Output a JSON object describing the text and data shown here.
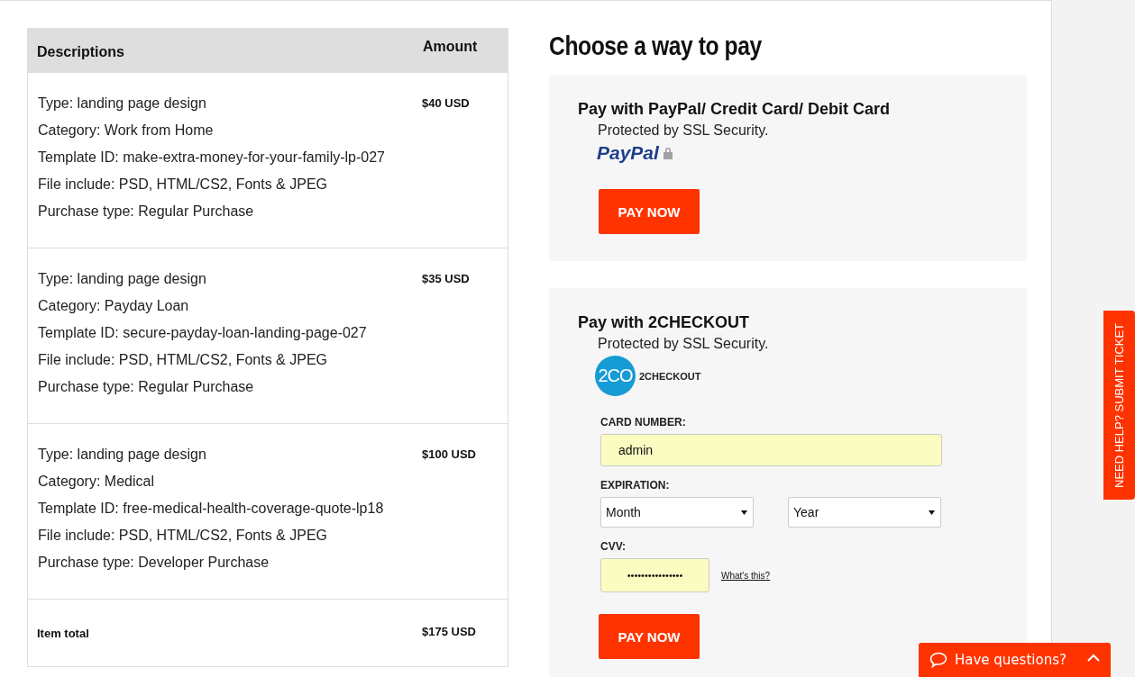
{
  "order_table": {
    "columns": [
      "Descriptions",
      "Amount"
    ],
    "items": [
      {
        "lines": [
          "Type: landing page design",
          "Category: Work from Home",
          "Template ID: make-extra-money-for-your-family-lp-027",
          "File include: PSD, HTML/CS2, Fonts & JPEG",
          "Purchase type: Regular Purchase"
        ],
        "amount": "$40 USD"
      },
      {
        "lines": [
          "Type: landing page design",
          "Category: Payday Loan",
          "Template ID: secure-payday-loan-landing-page-027",
          "File include: PSD, HTML/CS2, Fonts & JPEG",
          "Purchase type: Regular Purchase"
        ],
        "amount": "$35 USD"
      },
      {
        "lines": [
          "Type: landing page design",
          "Category: Medical",
          "Template ID: free-medical-health-coverage-quote-lp18",
          "File include: PSD, HTML/CS2, Fonts & JPEG",
          "Purchase type: Developer Purchase"
        ],
        "amount": "$100 USD"
      }
    ],
    "total": {
      "label": "Item total",
      "amount": "$175 USD"
    }
  },
  "payment": {
    "title": "Choose a way to pay",
    "paypal": {
      "heading": "Pay with PayPal/ Credit Card/ Debit Card",
      "note": "Protected by SSL Security.",
      "logo": "PayPal",
      "button": "PAY NOW"
    },
    "checkout": {
      "heading": "Pay with 2CHECKOUT",
      "note": "Protected by SSL Security.",
      "logo_badge": "2CO",
      "logo_text": "2CHECKOUT",
      "card_label": "CARD NUMBER:",
      "card_value": "admin",
      "expiration_label": "EXPIRATION:",
      "month": "Month",
      "year": "Year",
      "cvv_label": "CVV:",
      "cvv_value": "••••••••••••••••",
      "help_link": "What's this?",
      "button": "PAY NOW"
    }
  },
  "help_tab": "NEED HELP? SUBMIT TICKET",
  "chat_button": "Have questions?"
}
